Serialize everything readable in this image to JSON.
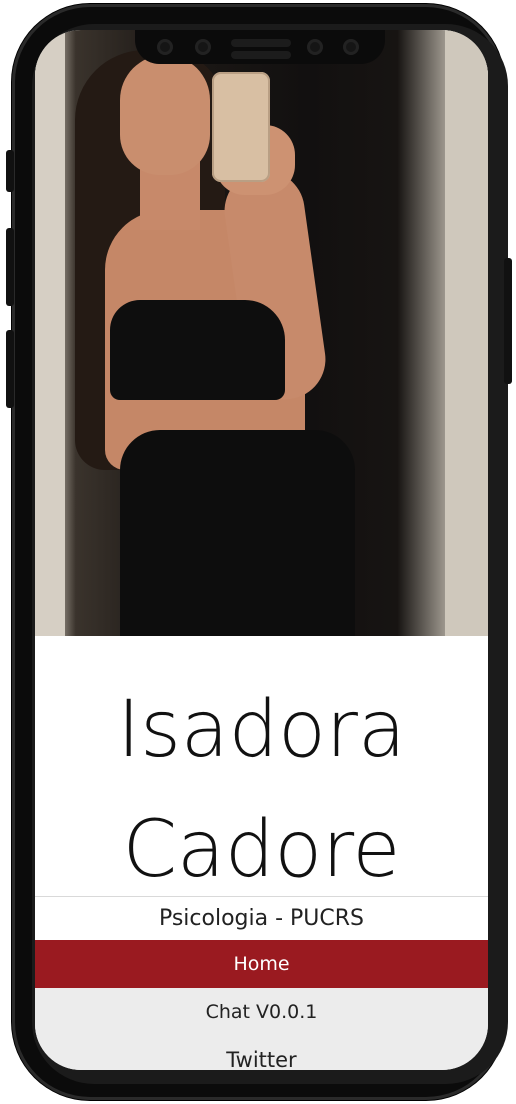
{
  "profile": {
    "first_name": "Isadora",
    "last_name": "Cadore",
    "subtitle": "Psicologia - PUCRS"
  },
  "nav": {
    "items": [
      {
        "label": "Home",
        "active": true
      },
      {
        "label": "Chat V0.0.1",
        "active": false
      },
      {
        "label": "Twitter",
        "active": false
      }
    ]
  },
  "colors": {
    "accent": "#9a1a20",
    "nav_background": "#ececec",
    "frame": "#0b0b0b"
  },
  "icons": [
    "front-camera-icon",
    "speaker-grill-icon"
  ]
}
